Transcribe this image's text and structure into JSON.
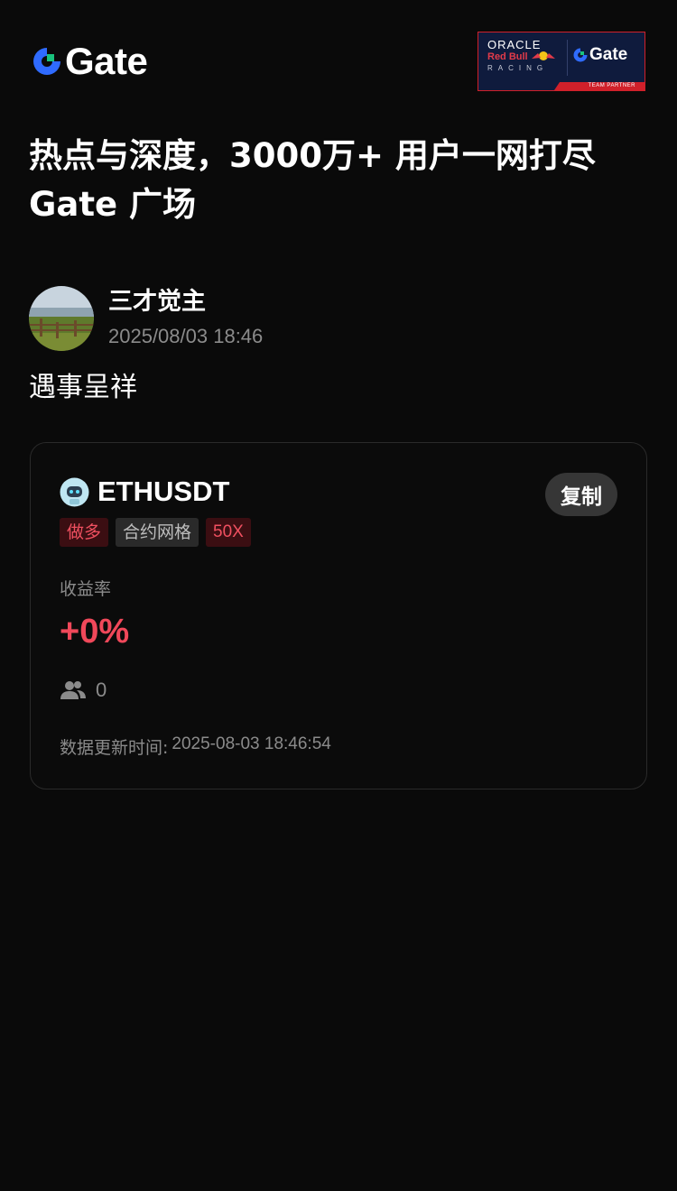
{
  "header": {
    "logo_text": "Gate",
    "partner_badge": {
      "oracle": "ORACLE",
      "red_bull": "Red Bull",
      "racing": "RACING",
      "gate": "Gate",
      "strip": "TEAM PARTNER"
    }
  },
  "headline": {
    "line1": "热点与深度，3000万+ 用户一网打尽",
    "line2": "Gate 广场"
  },
  "post": {
    "author_name": "三才觉主",
    "timestamp": "2025/08/03 18:46",
    "text": "遇事呈祥"
  },
  "card": {
    "pair": "ETHUSDT",
    "copy_label": "复制",
    "tags": {
      "direction": "做多",
      "strategy": "合约网格",
      "leverage": "50X"
    },
    "yield_label": "收益率",
    "yield_value": "+0%",
    "followers_count": "0",
    "updated_label": "数据更新时间:",
    "updated_time": "2025-08-03 18:46:54"
  },
  "colors": {
    "background": "#0a0a0a",
    "accent_blue": "#2f6bff",
    "accent_green": "#19c37d",
    "positive_red": "#f0485a",
    "muted_text": "#8b8b8b"
  },
  "icons": {
    "logo": "gate-logo-icon",
    "robot": "robot-icon",
    "followers": "users-icon"
  }
}
